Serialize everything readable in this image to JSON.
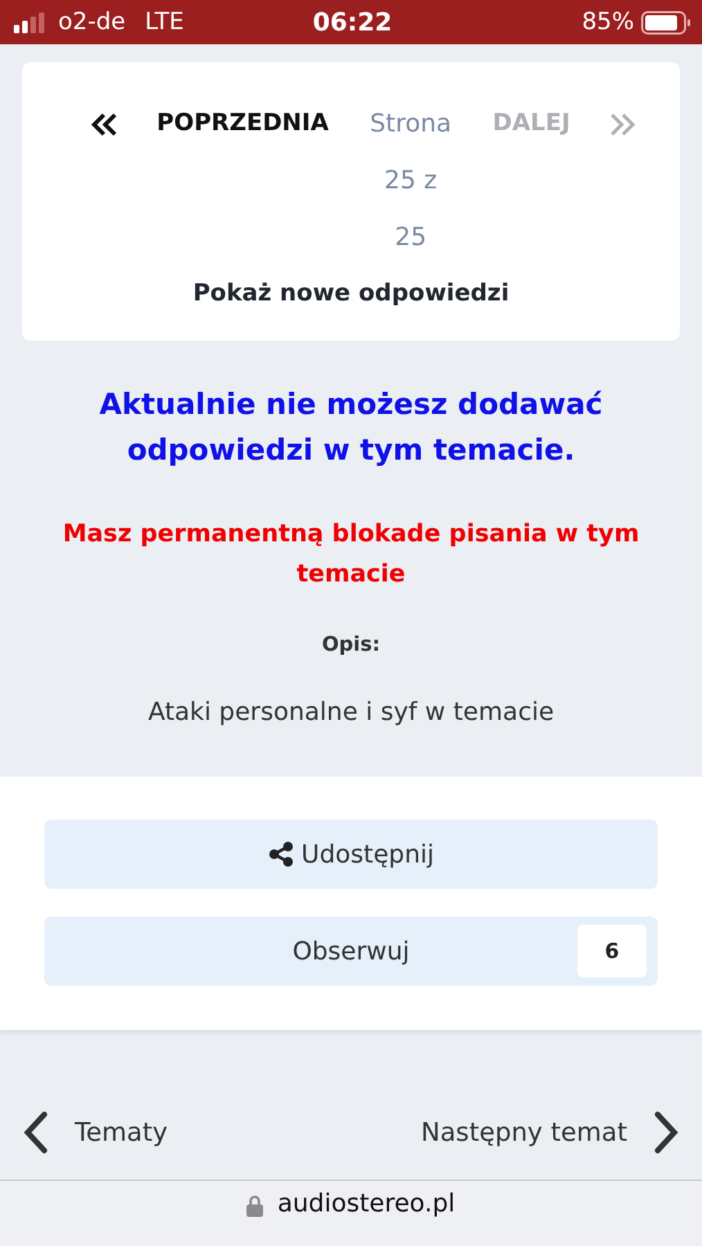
{
  "status_bar": {
    "carrier": "o2-de",
    "network": "LTE",
    "time": "06:22",
    "battery": "85%"
  },
  "pagination": {
    "previous": {
      "label": "POPRZEDNIA",
      "disabled": false
    },
    "page": "Strona 25 z 25",
    "next": {
      "label": "DALEJ",
      "disabled": true
    },
    "show_new": "Pokaż nowe odpowiedzi"
  },
  "notice": "Aktualnie nie możesz dodawać odpowiedzi w tym temacie.",
  "ban": "Masz permanentną blokade pisania w tym temacie",
  "description_label": "Opis:",
  "description": "Ataki personalne i syf w temacie",
  "share_button": "Udostępnij",
  "follow_button": {
    "label": "Obserwuj",
    "count": "6"
  },
  "topic_nav": {
    "back": "Tematy",
    "next": "Następny temat"
  },
  "address_bar": {
    "url": "audiostereo.pl"
  }
}
